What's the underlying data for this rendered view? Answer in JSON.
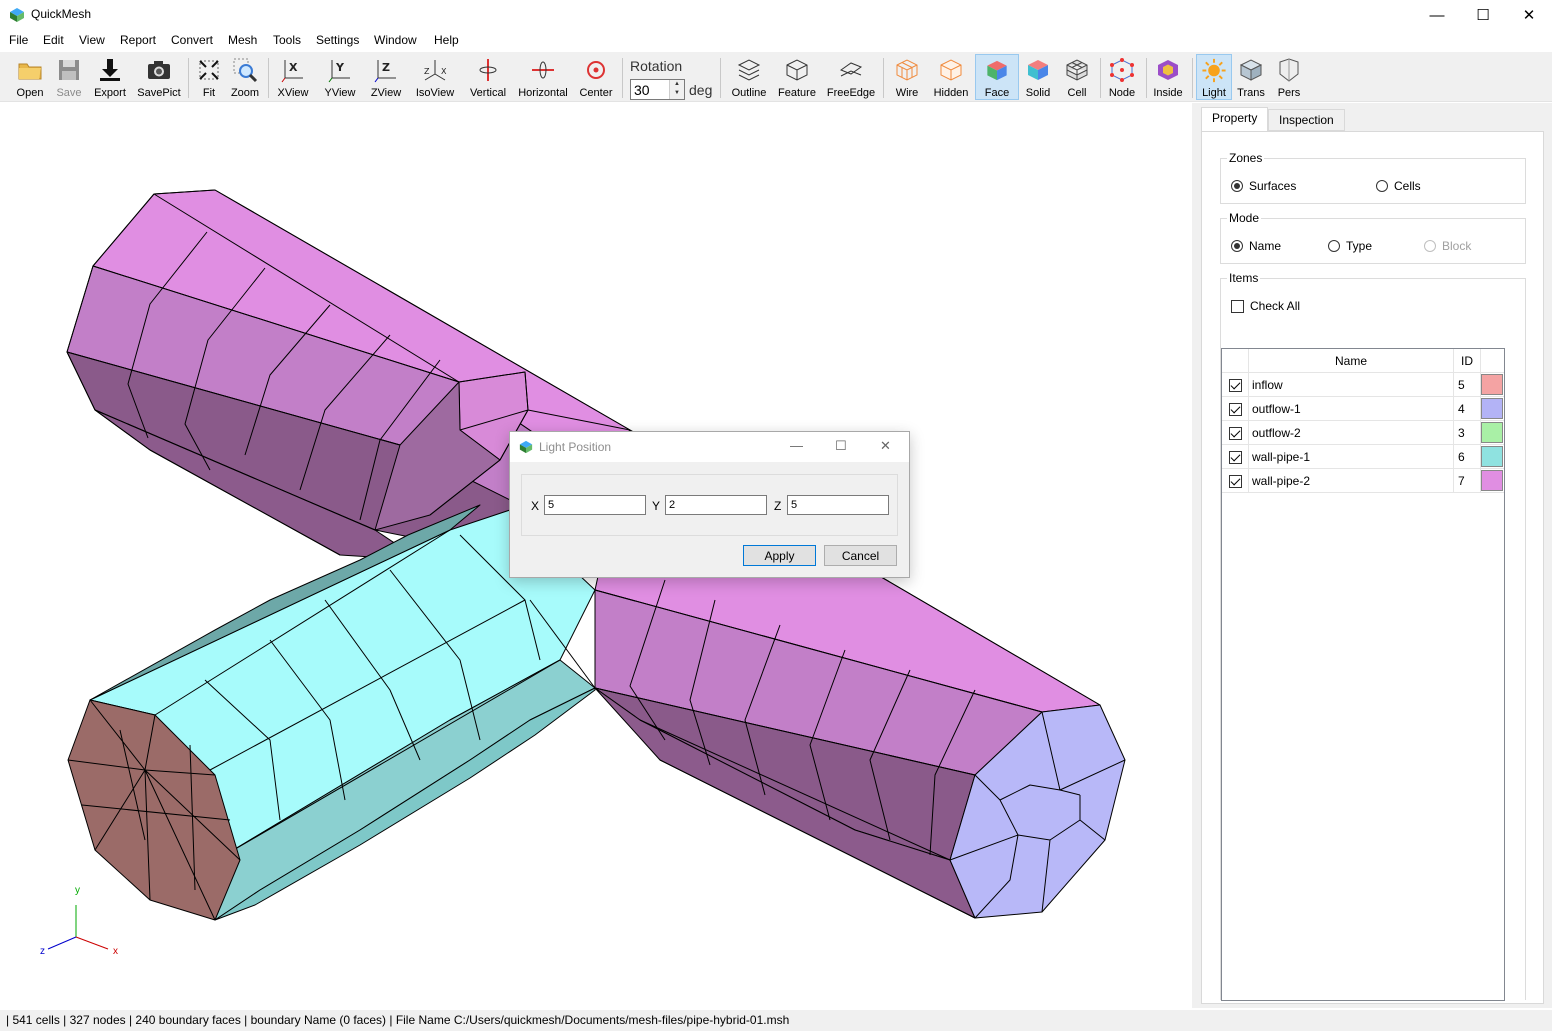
{
  "app": {
    "title": "QuickMesh"
  },
  "window_controls": {
    "minimize": "—",
    "maximize": "☐",
    "close": "✕"
  },
  "menu": [
    "File",
    "Edit",
    "View",
    "Report",
    "Convert",
    "Mesh",
    "Tools",
    "Settings",
    "Window",
    "Help"
  ],
  "toolbar": {
    "buttons": [
      {
        "label": "Open",
        "icon": "folder-icon"
      },
      {
        "label": "Save",
        "icon": "floppy-icon",
        "disabled": true
      },
      {
        "label": "Export",
        "icon": "download-icon"
      },
      {
        "label": "SavePict",
        "icon": "camera-icon"
      },
      {
        "label": "Fit",
        "icon": "fit-icon"
      },
      {
        "label": "Zoom",
        "icon": "zoom-icon"
      },
      {
        "label": "XView",
        "icon": "x-view-icon"
      },
      {
        "label": "YView",
        "icon": "y-view-icon"
      },
      {
        "label": "ZView",
        "icon": "z-view-icon"
      },
      {
        "label": "IsoView",
        "icon": "iso-view-icon"
      },
      {
        "label": "Vertical",
        "icon": "vertical-rotate-icon"
      },
      {
        "label": "Horizontal",
        "icon": "horizontal-rotate-icon"
      },
      {
        "label": "Center",
        "icon": "center-icon"
      },
      {
        "label": "Outline",
        "icon": "outline-icon"
      },
      {
        "label": "Feature",
        "icon": "feature-icon"
      },
      {
        "label": "FreeEdge",
        "icon": "free-edge-icon"
      },
      {
        "label": "Wire",
        "icon": "wire-icon"
      },
      {
        "label": "Hidden",
        "icon": "hidden-icon"
      },
      {
        "label": "Face",
        "icon": "face-icon",
        "active": true
      },
      {
        "label": "Solid",
        "icon": "solid-icon"
      },
      {
        "label": "Cell",
        "icon": "cell-icon"
      },
      {
        "label": "Node",
        "icon": "node-icon"
      },
      {
        "label": "Inside",
        "icon": "inside-icon"
      },
      {
        "label": "Light",
        "icon": "light-icon",
        "active": true
      },
      {
        "label": "Trans",
        "icon": "trans-icon"
      },
      {
        "label": "Pers",
        "icon": "pers-icon"
      }
    ],
    "rotation": {
      "label": "Rotation",
      "value": "30",
      "unit": "deg"
    }
  },
  "panel": {
    "tabs": [
      "Property",
      "Inspection"
    ],
    "zones": {
      "title": "Zones",
      "options": [
        "Surfaces",
        "Cells"
      ],
      "selected": "Surfaces"
    },
    "mode": {
      "title": "Mode",
      "options": [
        "Name",
        "Type",
        "Block"
      ],
      "selected": "Name",
      "disabled": [
        "Block"
      ]
    },
    "items": {
      "title": "Items",
      "check_all": "Check All",
      "columns": [
        "Name",
        "ID"
      ],
      "rows": [
        {
          "name": "inflow",
          "id": "5",
          "color": "#f4a3a3",
          "checked": true
        },
        {
          "name": "outflow-1",
          "id": "4",
          "color": "#b3b3f6",
          "checked": true
        },
        {
          "name": "outflow-2",
          "id": "3",
          "color": "#a9f0a6",
          "checked": true
        },
        {
          "name": "wall-pipe-1",
          "id": "6",
          "color": "#8fe2e0",
          "checked": true
        },
        {
          "name": "wall-pipe-2",
          "id": "7",
          "color": "#e08ee2",
          "checked": true
        }
      ]
    }
  },
  "dialog": {
    "title": "Light Position",
    "x_label": "X",
    "x_value": "5",
    "y_label": "Y",
    "y_value": "2",
    "z_label": "Z",
    "z_value": "5",
    "apply": "Apply",
    "cancel": "Cancel"
  },
  "axes": {
    "x": "x",
    "y": "y",
    "z": "z"
  },
  "status": "| 541 cells | 327 nodes | 240 boundary faces |  boundary Name  (0 faces) | File Name C:/Users/quickmesh/Documents/mesh-files/pipe-hybrid-01.msh"
}
